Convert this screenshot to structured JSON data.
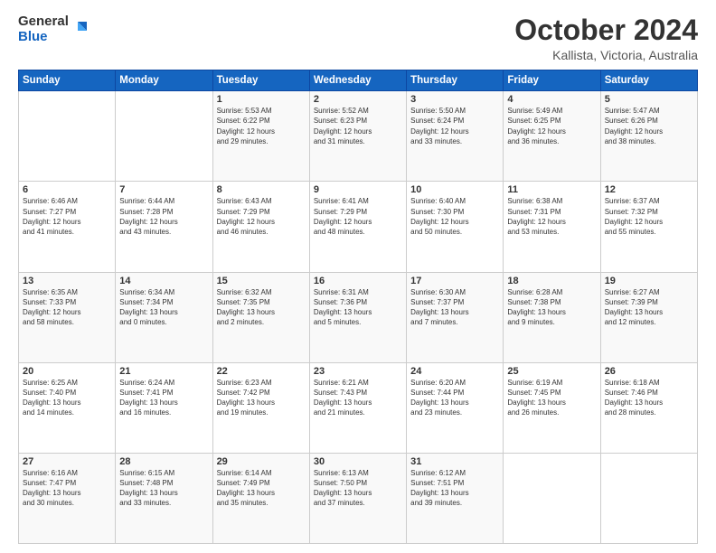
{
  "header": {
    "logo_general": "General",
    "logo_blue": "Blue",
    "month_title": "October 2024",
    "location": "Kallista, Victoria, Australia"
  },
  "weekdays": [
    "Sunday",
    "Monday",
    "Tuesday",
    "Wednesday",
    "Thursday",
    "Friday",
    "Saturday"
  ],
  "weeks": [
    [
      {
        "day": "",
        "info": ""
      },
      {
        "day": "",
        "info": ""
      },
      {
        "day": "1",
        "info": "Sunrise: 5:53 AM\nSunset: 6:22 PM\nDaylight: 12 hours\nand 29 minutes."
      },
      {
        "day": "2",
        "info": "Sunrise: 5:52 AM\nSunset: 6:23 PM\nDaylight: 12 hours\nand 31 minutes."
      },
      {
        "day": "3",
        "info": "Sunrise: 5:50 AM\nSunset: 6:24 PM\nDaylight: 12 hours\nand 33 minutes."
      },
      {
        "day": "4",
        "info": "Sunrise: 5:49 AM\nSunset: 6:25 PM\nDaylight: 12 hours\nand 36 minutes."
      },
      {
        "day": "5",
        "info": "Sunrise: 5:47 AM\nSunset: 6:26 PM\nDaylight: 12 hours\nand 38 minutes."
      }
    ],
    [
      {
        "day": "6",
        "info": "Sunrise: 6:46 AM\nSunset: 7:27 PM\nDaylight: 12 hours\nand 41 minutes."
      },
      {
        "day": "7",
        "info": "Sunrise: 6:44 AM\nSunset: 7:28 PM\nDaylight: 12 hours\nand 43 minutes."
      },
      {
        "day": "8",
        "info": "Sunrise: 6:43 AM\nSunset: 7:29 PM\nDaylight: 12 hours\nand 46 minutes."
      },
      {
        "day": "9",
        "info": "Sunrise: 6:41 AM\nSunset: 7:29 PM\nDaylight: 12 hours\nand 48 minutes."
      },
      {
        "day": "10",
        "info": "Sunrise: 6:40 AM\nSunset: 7:30 PM\nDaylight: 12 hours\nand 50 minutes."
      },
      {
        "day": "11",
        "info": "Sunrise: 6:38 AM\nSunset: 7:31 PM\nDaylight: 12 hours\nand 53 minutes."
      },
      {
        "day": "12",
        "info": "Sunrise: 6:37 AM\nSunset: 7:32 PM\nDaylight: 12 hours\nand 55 minutes."
      }
    ],
    [
      {
        "day": "13",
        "info": "Sunrise: 6:35 AM\nSunset: 7:33 PM\nDaylight: 12 hours\nand 58 minutes."
      },
      {
        "day": "14",
        "info": "Sunrise: 6:34 AM\nSunset: 7:34 PM\nDaylight: 13 hours\nand 0 minutes."
      },
      {
        "day": "15",
        "info": "Sunrise: 6:32 AM\nSunset: 7:35 PM\nDaylight: 13 hours\nand 2 minutes."
      },
      {
        "day": "16",
        "info": "Sunrise: 6:31 AM\nSunset: 7:36 PM\nDaylight: 13 hours\nand 5 minutes."
      },
      {
        "day": "17",
        "info": "Sunrise: 6:30 AM\nSunset: 7:37 PM\nDaylight: 13 hours\nand 7 minutes."
      },
      {
        "day": "18",
        "info": "Sunrise: 6:28 AM\nSunset: 7:38 PM\nDaylight: 13 hours\nand 9 minutes."
      },
      {
        "day": "19",
        "info": "Sunrise: 6:27 AM\nSunset: 7:39 PM\nDaylight: 13 hours\nand 12 minutes."
      }
    ],
    [
      {
        "day": "20",
        "info": "Sunrise: 6:25 AM\nSunset: 7:40 PM\nDaylight: 13 hours\nand 14 minutes."
      },
      {
        "day": "21",
        "info": "Sunrise: 6:24 AM\nSunset: 7:41 PM\nDaylight: 13 hours\nand 16 minutes."
      },
      {
        "day": "22",
        "info": "Sunrise: 6:23 AM\nSunset: 7:42 PM\nDaylight: 13 hours\nand 19 minutes."
      },
      {
        "day": "23",
        "info": "Sunrise: 6:21 AM\nSunset: 7:43 PM\nDaylight: 13 hours\nand 21 minutes."
      },
      {
        "day": "24",
        "info": "Sunrise: 6:20 AM\nSunset: 7:44 PM\nDaylight: 13 hours\nand 23 minutes."
      },
      {
        "day": "25",
        "info": "Sunrise: 6:19 AM\nSunset: 7:45 PM\nDaylight: 13 hours\nand 26 minutes."
      },
      {
        "day": "26",
        "info": "Sunrise: 6:18 AM\nSunset: 7:46 PM\nDaylight: 13 hours\nand 28 minutes."
      }
    ],
    [
      {
        "day": "27",
        "info": "Sunrise: 6:16 AM\nSunset: 7:47 PM\nDaylight: 13 hours\nand 30 minutes."
      },
      {
        "day": "28",
        "info": "Sunrise: 6:15 AM\nSunset: 7:48 PM\nDaylight: 13 hours\nand 33 minutes."
      },
      {
        "day": "29",
        "info": "Sunrise: 6:14 AM\nSunset: 7:49 PM\nDaylight: 13 hours\nand 35 minutes."
      },
      {
        "day": "30",
        "info": "Sunrise: 6:13 AM\nSunset: 7:50 PM\nDaylight: 13 hours\nand 37 minutes."
      },
      {
        "day": "31",
        "info": "Sunrise: 6:12 AM\nSunset: 7:51 PM\nDaylight: 13 hours\nand 39 minutes."
      },
      {
        "day": "",
        "info": ""
      },
      {
        "day": "",
        "info": ""
      }
    ]
  ]
}
